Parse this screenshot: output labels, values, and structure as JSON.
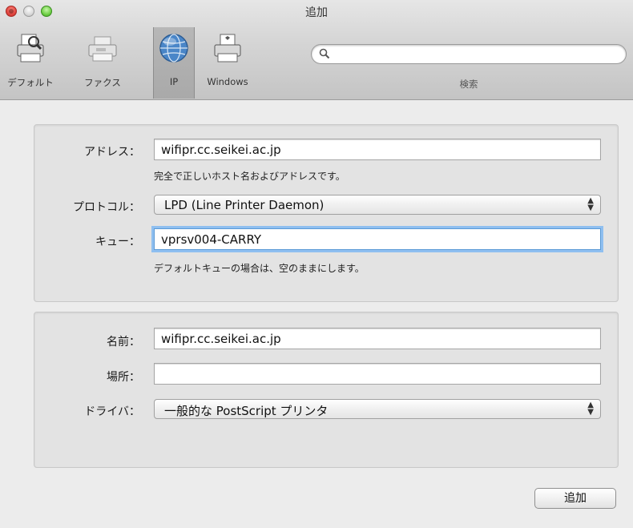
{
  "window": {
    "title": "追加"
  },
  "toolbar": {
    "items": [
      {
        "label": "デフォルト",
        "icon": "default-printer-icon"
      },
      {
        "label": "ファクス",
        "icon": "fax-icon"
      },
      {
        "label": "IP",
        "icon": "globe-icon",
        "selected": true
      },
      {
        "label": "Windows",
        "icon": "windows-printer-icon"
      }
    ],
    "search": {
      "label": "検索",
      "value": ""
    }
  },
  "connection": {
    "address_label": "アドレス：",
    "address_value": "wifipr.cc.seikei.ac.jp",
    "address_hint": "完全で正しいホスト名およびアドレスです。",
    "protocol_label": "プロトコル：",
    "protocol_value": "LPD (Line Printer Daemon)",
    "queue_label": "キュー：",
    "queue_value": "vprsv004-CARRY",
    "queue_hint": "デフォルトキューの場合は、空のままにします。"
  },
  "printer": {
    "name_label": "名前：",
    "name_value": "wifipr.cc.seikei.ac.jp",
    "location_label": "場所：",
    "location_value": "",
    "driver_label": "ドライバ：",
    "driver_value": "一般的な PostScript プリンタ"
  },
  "footer": {
    "add_label": "追加"
  },
  "colors": {
    "focus_ring": "#8fbff0",
    "close": "#e0443e",
    "zoom": "#6fcf46"
  }
}
